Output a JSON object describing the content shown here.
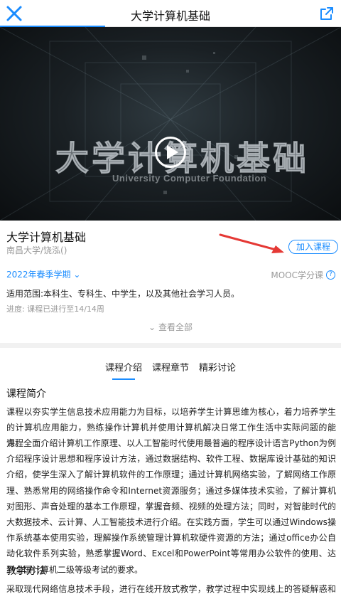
{
  "header": {
    "title": "大学计算机基础",
    "close_icon": "close-icon",
    "share_icon": "share-icon",
    "accent": "#1a8cff"
  },
  "video": {
    "watermark_title": "大学计算机基础",
    "watermark_subtitle": "University Computer Foundation",
    "play_icon": "play-icon"
  },
  "course": {
    "title": "大学计算机基础",
    "meta": "南昌大学/饶泓()",
    "join_label": "加入课程",
    "semester": "2022年春季学期",
    "mooc_label": "MOOC学分课",
    "scope": "适用范围:本科生、专科生、中学生，以及其他社会学习人员。",
    "progress": "进度: 课程已进行至14/14周",
    "view_all": "查看全部"
  },
  "tabs": [
    {
      "label": "课程介绍",
      "active": true
    },
    {
      "label": "课程章节",
      "active": false
    },
    {
      "label": "精彩讨论",
      "active": false
    }
  ],
  "content": {
    "intro_heading": "课程简介",
    "intro_p1": "课程以夯实学生信息技术应用能力为目标，以培养学生计算思维为核心，着力培养学生的计算机应用能力，熟练操作计算机并使用计算机解决日常工作生活中实际问题的能力。",
    "intro_p2": "课程全面介绍计算机工作原理、以人工智能时代使用最普遍的程序设计语言Python为例介绍程序设计思想和程序设计方法，通过数据结构、软件工程、数据库设计基础的知识介绍，使学生深入了解计算机软件的工作原理；通过计算机网络实验，了解网络工作原理、熟悉常用的网络操作命令和Internet资源服务；通过多媒体技术实验，了解计算机对图形、声音处理的基本工作原理，掌握音频、视频的处理方法；同时，对智能时代的大数据技术、云计算、人工智能技术进行介绍。在实践方面，学生可以通过Windows操作系统基本使用实验，理解操作系统管理计算机软硬件资源的方法；通过office办公自动化软件系列实验，熟悉掌握Word、Excel和PowerPoint等常用办公软件的使用、达到全国计算机二级等级考试的要求。",
    "method_heading": "教学方法",
    "method_p1": "采取现代网络信息技术手段，进行在线开放式教学，教学过程中实现线上的答疑解惑和专题讨"
  }
}
